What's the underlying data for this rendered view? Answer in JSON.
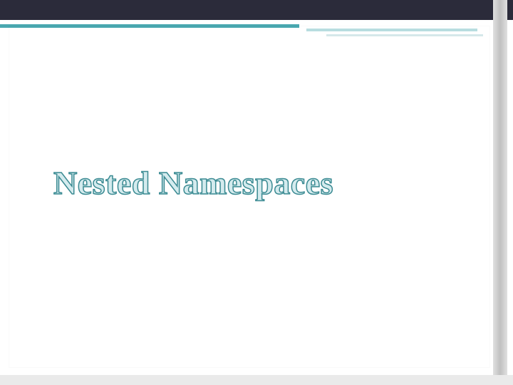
{
  "slide": {
    "title": "Nested Namespaces"
  }
}
